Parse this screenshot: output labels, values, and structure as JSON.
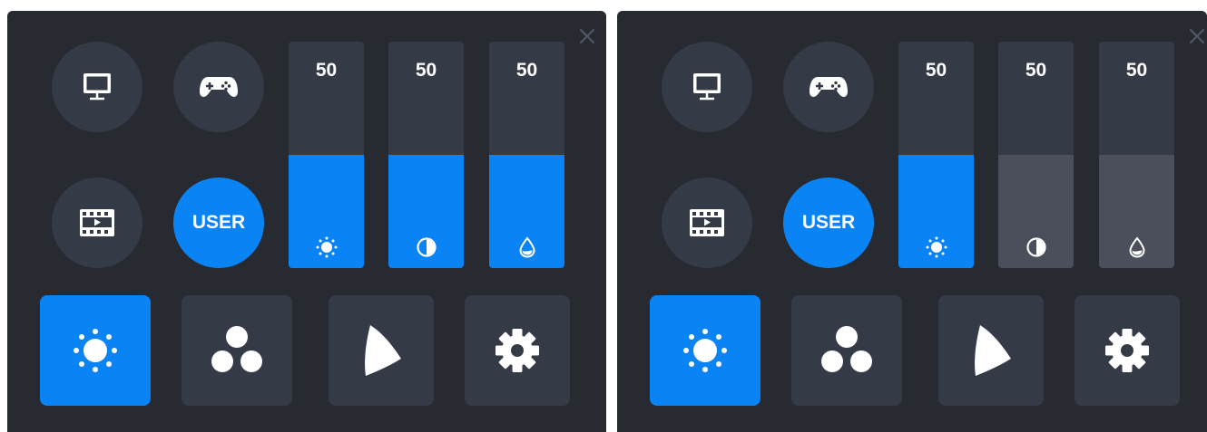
{
  "colors": {
    "panel_bg": "#272a31",
    "tile_bg": "#343a46",
    "accent": "#0a84f5",
    "inactive_fill": "#4b4f5c",
    "text": "#ffffff"
  },
  "panels": [
    {
      "close_icon": "close-icon",
      "modes": [
        {
          "icon": "monitor-icon"
        },
        {
          "icon": "gamepad-icon"
        },
        {
          "icon": "movie-icon"
        },
        {
          "label": "USER",
          "active": true
        }
      ],
      "sliders": [
        {
          "value": "50",
          "level": 0.5,
          "icon": "brightness-icon",
          "active": true
        },
        {
          "value": "50",
          "level": 0.5,
          "icon": "contrast-icon",
          "active": true
        },
        {
          "value": "50",
          "level": 0.5,
          "icon": "saturation-icon",
          "active": true
        }
      ],
      "tabs": [
        {
          "icon": "brightness-tab-icon",
          "active": true
        },
        {
          "icon": "color-dots-icon",
          "active": false
        },
        {
          "icon": "gamma-icon",
          "active": false
        },
        {
          "icon": "settings-gear-icon",
          "active": false
        }
      ]
    },
    {
      "close_icon": "close-icon",
      "modes": [
        {
          "icon": "monitor-icon"
        },
        {
          "icon": "gamepad-icon"
        },
        {
          "icon": "movie-icon"
        },
        {
          "label": "USER",
          "active": true
        }
      ],
      "sliders": [
        {
          "value": "50",
          "level": 0.5,
          "icon": "brightness-icon",
          "active": true
        },
        {
          "value": "50",
          "level": 0.5,
          "icon": "contrast-icon",
          "active": false
        },
        {
          "value": "50",
          "level": 0.5,
          "icon": "saturation-icon",
          "active": false
        }
      ],
      "tabs": [
        {
          "icon": "brightness-tab-icon",
          "active": true
        },
        {
          "icon": "color-dots-icon",
          "active": false
        },
        {
          "icon": "gamma-icon",
          "active": false
        },
        {
          "icon": "settings-gear-icon",
          "active": false
        }
      ]
    }
  ]
}
